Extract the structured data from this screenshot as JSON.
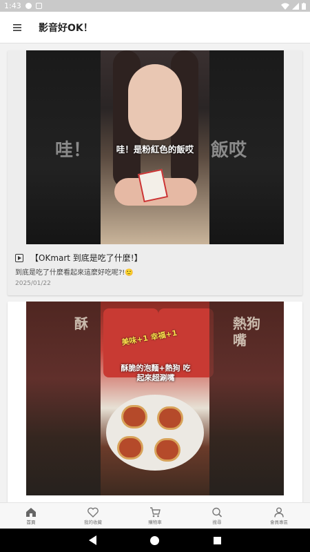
{
  "status": {
    "time": "1:43"
  },
  "app": {
    "title": "影音好OK！"
  },
  "videos": [
    {
      "title": "【OKmart 到底是吃了什麼!】",
      "description": "到底是吃了什麼看起來這麼好吃呢?!🙂",
      "date": "2025/01/22",
      "overlay_caption": "哇！是粉紅色的飯哎",
      "ghost_left": "哇！",
      "ghost_right": "飯哎"
    },
    {
      "overlay_top": "美味+1 幸福+1",
      "overlay_caption": "酥脆的泡麵+熱狗 吃起來超涮嘴",
      "ghost_left": "酥",
      "ghost_right": "熱狗 嘴"
    }
  ],
  "tabs": [
    {
      "label": "首頁",
      "icon": "home-icon"
    },
    {
      "label": "我的收藏",
      "icon": "heart-icon"
    },
    {
      "label": "購物車",
      "icon": "cart-icon"
    },
    {
      "label": "搜尋",
      "icon": "search-icon"
    },
    {
      "label": "會員專區",
      "icon": "user-icon"
    }
  ],
  "colors": {
    "accent": "#555555",
    "card_bg": "#ededed",
    "app_bar": "#ffffff"
  }
}
